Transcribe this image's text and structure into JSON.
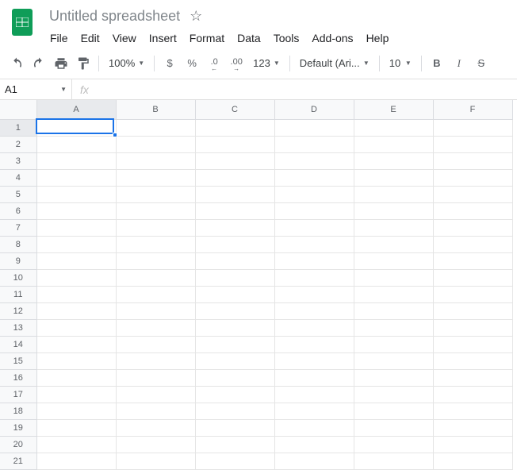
{
  "doc": {
    "title": "Untitled spreadsheet"
  },
  "menubar": {
    "file": "File",
    "edit": "Edit",
    "view": "View",
    "insert": "Insert",
    "format": "Format",
    "data": "Data",
    "tools": "Tools",
    "addons": "Add-ons",
    "help": "Help"
  },
  "toolbar": {
    "zoom": "100%",
    "dollar": "$",
    "percent": "%",
    "dec_less": ".0",
    "dec_more": ".00",
    "more_formats": "123",
    "font": "Default (Ari...",
    "font_size": "10",
    "bold": "B",
    "italic": "I",
    "strike": "S"
  },
  "namebox": {
    "value": "A1",
    "fx": "fx"
  },
  "grid": {
    "columns": [
      "A",
      "B",
      "C",
      "D",
      "E",
      "F"
    ],
    "rows": [
      "1",
      "2",
      "3",
      "4",
      "5",
      "6",
      "7",
      "8",
      "9",
      "10",
      "11",
      "12",
      "13",
      "14",
      "15",
      "16",
      "17",
      "18",
      "19",
      "20",
      "21"
    ],
    "selected": {
      "col": 0,
      "row": 0
    }
  }
}
